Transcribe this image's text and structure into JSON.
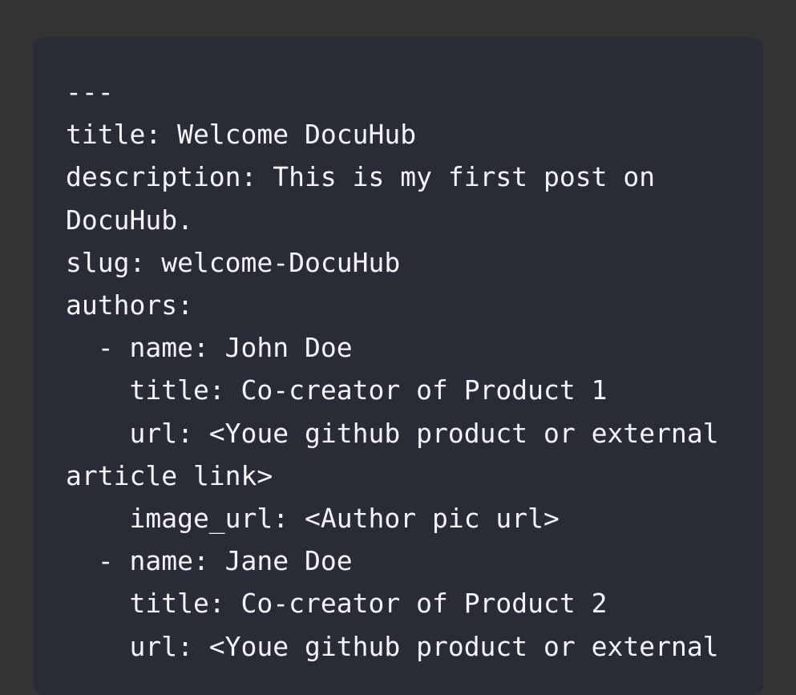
{
  "code": {
    "lines": [
      "---",
      "title: Welcome DocuHub",
      "description: This is my first post on",
      "DocuHub.",
      "slug: welcome-DocuHub",
      "authors:",
      "  - name: John Doe",
      "    title: Co-creator of Product 1",
      "    url: <Youe github product or external",
      "article link>",
      "    image_url: <Author pic url>",
      "  - name: Jane Doe",
      "    title: Co-creator of Product 2",
      "    url: <Youe github product or external"
    ]
  },
  "colors": {
    "page_background": "#333333",
    "code_background": "#292b37",
    "code_text": "#f4f4f6"
  }
}
